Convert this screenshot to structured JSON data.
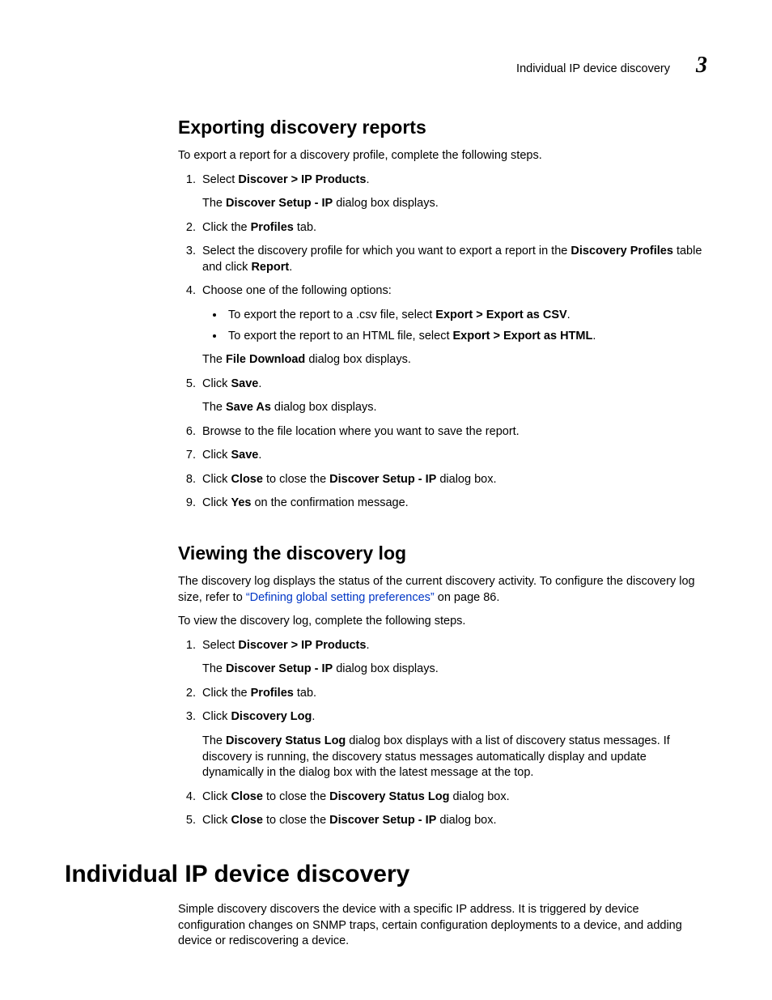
{
  "header": {
    "running_title": "Individual IP device discovery",
    "chapter_number": "3"
  },
  "s1": {
    "heading": "Exporting discovery reports",
    "intro": "To export a report for a discovery profile, complete the following steps.",
    "step1_pre": "Select ",
    "step1_b": "Discover > IP Products",
    "step1_post": ".",
    "step1_sub_pre": "The ",
    "step1_sub_b": "Discover Setup - IP",
    "step1_sub_post": " dialog box displays.",
    "step2_pre": "Click the ",
    "step2_b": "Profiles",
    "step2_post": " tab.",
    "step3_pre": "Select the discovery profile for which you want to export a report in the ",
    "step3_b1": "Discovery Profiles",
    "step3_mid": " table and click ",
    "step3_b2": "Report",
    "step3_post": ".",
    "step4": "Choose one of the following options:",
    "step4_b1_pre": "To export the report to a .csv file, select ",
    "step4_b1_b": "Export > Export as CSV",
    "step4_b1_post": ".",
    "step4_b2_pre": "To export the report to an HTML file, select ",
    "step4_b2_b": "Export > Export as HTML",
    "step4_b2_post": ".",
    "step4_sub_pre": "The ",
    "step4_sub_b": "File Download",
    "step4_sub_post": " dialog box displays.",
    "step5_pre": "Click ",
    "step5_b": "Save",
    "step5_post": ".",
    "step5_sub_pre": "The ",
    "step5_sub_b": "Save As",
    "step5_sub_post": " dialog box displays.",
    "step6": "Browse to the file location where you want to save the report.",
    "step7_pre": "Click ",
    "step7_b": "Save",
    "step7_post": ".",
    "step8_pre": "Click ",
    "step8_b1": "Close",
    "step8_mid": " to close the ",
    "step8_b2": "Discover Setup - IP",
    "step8_post": " dialog box.",
    "step9_pre": "Click ",
    "step9_b": "Yes",
    "step9_post": " on the confirmation message."
  },
  "s2": {
    "heading": "Viewing the discovery log",
    "intro_pre": "The discovery log displays the status of the current discovery activity. To configure the discovery log size, refer to ",
    "intro_link": "“Defining global setting preferences”",
    "intro_post": " on page 86.",
    "intro2": "To view the discovery log, complete the following steps.",
    "step1_pre": "Select ",
    "step1_b": "Discover > IP Products",
    "step1_post": ".",
    "step1_sub_pre": "The ",
    "step1_sub_b": "Discover Setup - IP",
    "step1_sub_post": " dialog box displays.",
    "step2_pre": "Click the ",
    "step2_b": "Profiles",
    "step2_post": " tab.",
    "step3_pre": "Click ",
    "step3_b": "Discovery Log",
    "step3_post": ".",
    "step3_sub_pre": "The ",
    "step3_sub_b": "Discovery Status Log",
    "step3_sub_post": " dialog box displays with a list of discovery status messages. If discovery is running, the discovery status messages automatically display and update dynamically in the dialog box with the latest message at the top.",
    "step4_pre": "Click ",
    "step4_b1": "Close",
    "step4_mid": " to close the ",
    "step4_b2": "Discovery Status Log",
    "step4_post": " dialog box.",
    "step5_pre": "Click ",
    "step5_b1": "Close",
    "step5_mid": " to close the ",
    "step5_b2": "Discover Setup - IP",
    "step5_post": " dialog box."
  },
  "s3": {
    "heading": "Individual IP device discovery",
    "body": "Simple discovery discovers the device with a specific IP address. It is triggered by device configuration changes on SNMP traps, certain configuration deployments to a device, and adding device or rediscovering a device."
  }
}
